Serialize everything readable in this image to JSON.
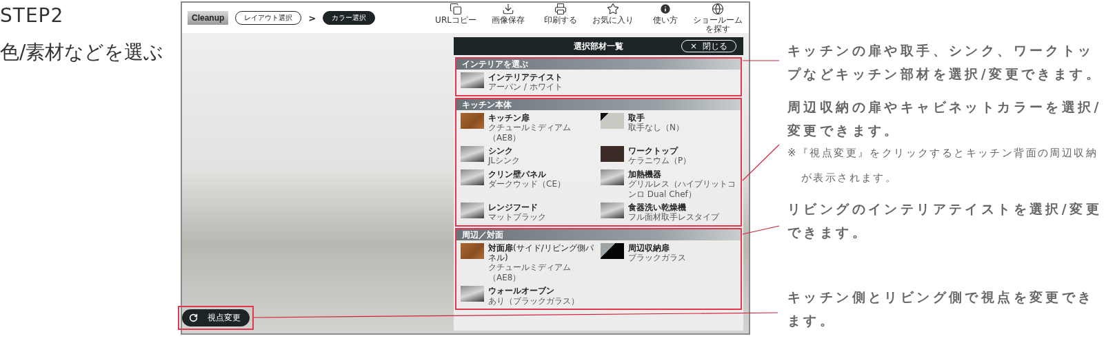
{
  "heading": {
    "step": "STEP2",
    "title": "色/素材などを選ぶ"
  },
  "app": {
    "logo": "Cleanup",
    "breadcrumbs": [
      {
        "label": "レイアウト選択",
        "selected": false
      },
      {
        "label": "カラー選択",
        "selected": true
      }
    ],
    "breadcrumb_separator": ">",
    "toolbar": [
      {
        "kind": "copy",
        "label": "URLコピー"
      },
      {
        "kind": "save",
        "label": "画像保存"
      },
      {
        "kind": "print",
        "label": "印刷する"
      },
      {
        "kind": "favorite",
        "label": "お気に入り"
      },
      {
        "kind": "help",
        "label": "使い方"
      },
      {
        "kind": "globe",
        "label": "ショールームを探す"
      }
    ],
    "panel": {
      "title": "選択部材一覧",
      "close_icon": "×",
      "close": "閉じる",
      "sections": [
        {
          "title": "インテリアを選ぶ",
          "items": [
            {
              "name": "インテリアテイスト",
              "value": "アーバン / ホワイト",
              "kind": "photo"
            }
          ]
        },
        {
          "title": "キッチン本体",
          "items": [
            {
              "name": "キッチン扉",
              "value": "クチュールミディアム（AE8）",
              "kind": "wood"
            },
            {
              "name": "取手",
              "value": "取手なし（N）",
              "kind": "handle"
            },
            {
              "name": "シンク",
              "value": "JLシンク",
              "kind": "photo"
            },
            {
              "name": "ワークトップ",
              "value": "ケラニウム（P）",
              "kind": "dark"
            },
            {
              "name": "クリン壁パネル",
              "value": "ダークウッド（CE）",
              "kind": "photo"
            },
            {
              "name": "加熱機器",
              "value": "グリルレス（ハイブリットコンロ Dual Chef）",
              "kind": "photo"
            },
            {
              "name": "レンジフード",
              "value": "マットブラック",
              "kind": "photo"
            },
            {
              "name": "食器洗い乾燥機",
              "value": "フル面材取手レスタイプ",
              "kind": "photo"
            }
          ]
        },
        {
          "title": "周辺／対面",
          "items": [
            {
              "name": "対面扉",
              "note": "(サイド/リビング側パネル)",
              "value": "クチュールミディアム（AE8）",
              "kind": "wood"
            },
            {
              "name": "周辺収納扉",
              "value": "ブラックガラス",
              "kind": "glass"
            },
            {
              "name": "ウォールオーブン",
              "value": "あり（ブラックガラス）",
              "kind": "photo"
            }
          ]
        }
      ]
    },
    "view_button": "視点変更"
  },
  "annotations": [
    {
      "text": "キッチンの扉や取手、シンク、ワークトップなどキッチン部材を選択/変更できます。"
    },
    {
      "text": "周辺収納の扉やキャビネットカラーを選択/変更できます。",
      "note": "※『視点変更』をクリックするとキッチン背面の周辺収納が表示されます。"
    },
    {
      "text": "リビングのインテリアテイストを選択/変更できます。"
    },
    {
      "text": "キッチン側とリビング側で視点を変更できます。"
    }
  ]
}
